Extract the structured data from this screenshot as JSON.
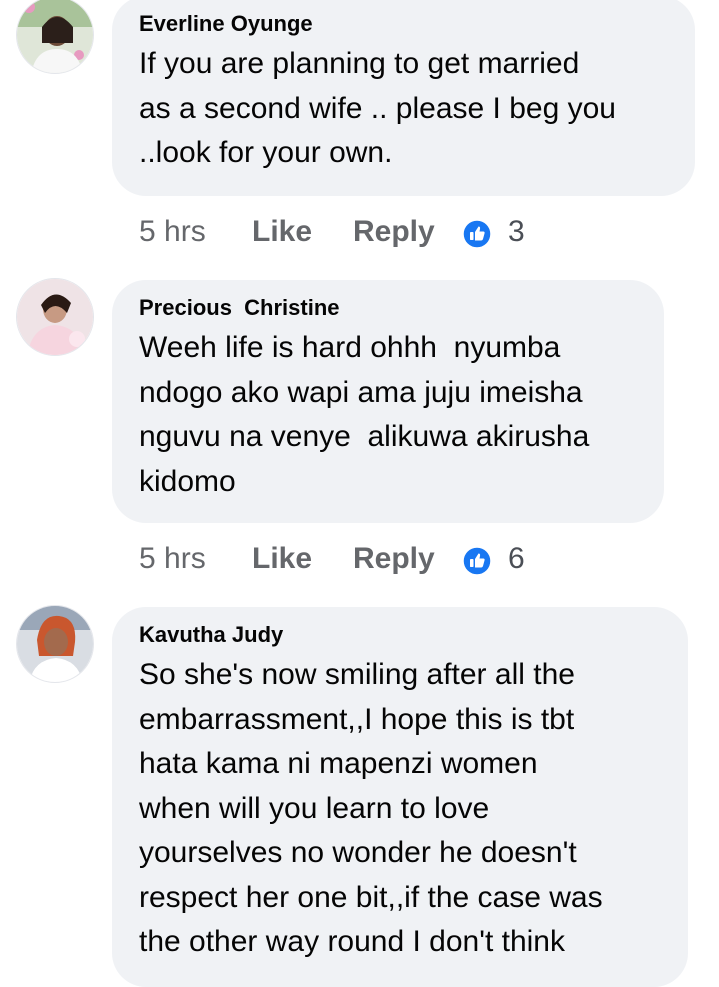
{
  "colors": {
    "bubble": "#f0f2f5",
    "meta": "#65676b",
    "like_icon": "#1877f2"
  },
  "comments": [
    {
      "author": "Everline Oyunge",
      "avatar_icon": "profile-photo",
      "lines": [
        "If you are planning to get married",
        "as a second wife .. please I beg you",
        "..look for your own."
      ],
      "time": "5 hrs",
      "like_label": "Like",
      "reply_label": "Reply",
      "reaction_icon": "thumbs-up-icon",
      "reaction_count": "3"
    },
    {
      "author": "Precious  Christine",
      "avatar_icon": "profile-photo",
      "lines": [
        "Weeh life is hard ohhh  nyumba",
        "ndogo ako wapi ama juju imeisha",
        "nguvu na venye  alikuwa akirusha",
        "kidomo"
      ],
      "time": "5 hrs",
      "like_label": "Like",
      "reply_label": "Reply",
      "reaction_icon": "thumbs-up-icon",
      "reaction_count": "6"
    },
    {
      "author": "Kavutha Judy",
      "avatar_icon": "profile-photo",
      "lines": [
        "So she's now smiling after all the",
        "embarrassment,,I hope this is tbt",
        "hata kama ni mapenzi women",
        "when will you learn to love",
        "yourselves no wonder he doesn't",
        "respect her one bit,,if the case was",
        "the other way round I don't think"
      ]
    }
  ]
}
